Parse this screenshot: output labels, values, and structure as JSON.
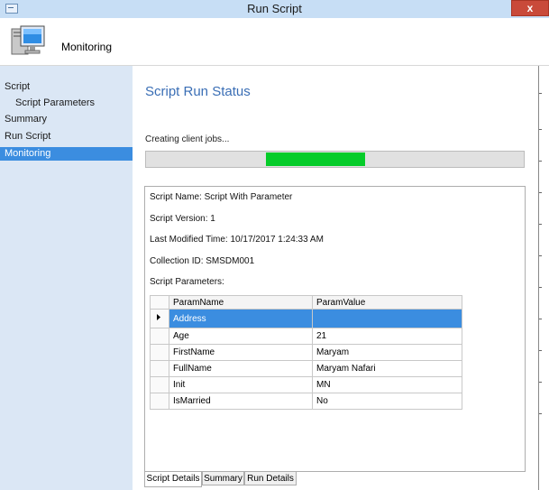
{
  "window": {
    "title": "Run Script",
    "close_label": "x"
  },
  "header": {
    "title": "Monitoring",
    "icon": "computer-monitor-icon"
  },
  "sidebar": {
    "items": [
      {
        "label": "Script",
        "indent": false,
        "selected": false
      },
      {
        "label": "Script Parameters",
        "indent": true,
        "selected": false
      },
      {
        "label": "Summary",
        "indent": false,
        "selected": false
      },
      {
        "label": "Run Script",
        "indent": false,
        "selected": false
      },
      {
        "label": "Monitoring",
        "indent": false,
        "selected": true
      }
    ]
  },
  "main": {
    "title": "Script Run Status",
    "status_text": "Creating client jobs...",
    "progress": {
      "visible_segment": "indeterminate",
      "color": "#06cc2a"
    },
    "details": {
      "script_name": "Script Name: Script With Parameter",
      "script_version": "Script Version: 1",
      "last_modified": "Last Modified Time: 10/17/2017 1:24:33 AM",
      "collection_id": "Collection ID: SMSDM001",
      "params_label": "Script Parameters:"
    },
    "grid": {
      "columns": [
        "ParamName",
        "ParamValue"
      ],
      "rows": [
        {
          "name": "Address",
          "value": "",
          "selected": true
        },
        {
          "name": "Age",
          "value": "21",
          "selected": false
        },
        {
          "name": "FirstName",
          "value": "Maryam",
          "selected": false
        },
        {
          "name": "FullName",
          "value": "Maryam Nafari",
          "selected": false
        },
        {
          "name": "Init",
          "value": "MN",
          "selected": false
        },
        {
          "name": "IsMarried",
          "value": "No",
          "selected": false
        }
      ]
    },
    "tabs": [
      {
        "label": "Script Details",
        "active": true
      },
      {
        "label": "Summary",
        "active": false
      },
      {
        "label": "Run Details",
        "active": false
      }
    ]
  },
  "colors": {
    "accent": "#3b8de0",
    "sidebar_bg": "#dbe7f5",
    "title_blue": "#3a6eb5"
  }
}
